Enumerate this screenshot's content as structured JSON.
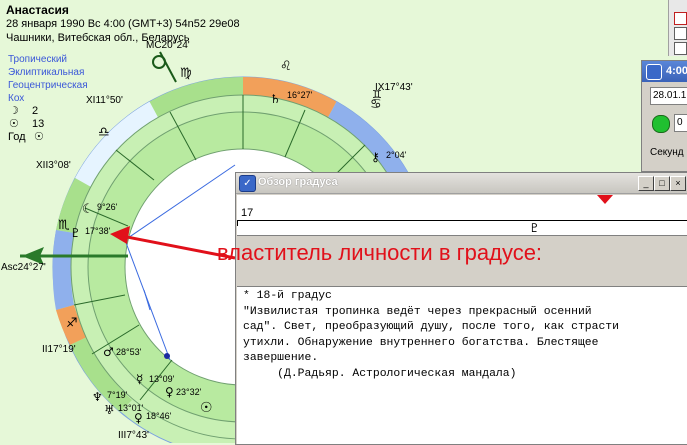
{
  "header": {
    "name": "Анастасия",
    "date_line": "28 января 1990  Вс    4:00 (GMT+3) 54n52  29e08",
    "place_line": "Чашники, Витебская обл., Беларусь"
  },
  "settings": {
    "zodiac": "Тропический",
    "coordinates": "Эклиптикальная",
    "center": "Геоцентрическая",
    "house_system": "Кох",
    "moon_value": "2",
    "sun_value": "13",
    "year_label": "Год"
  },
  "houses": {
    "mc": "MC20°24'",
    "xi": "XI11°50'",
    "xii": "XII3°08'",
    "asc": "Asc24°27'",
    "ii": "II17°19'",
    "iii": "III7°43'",
    "ix": "IX17°43'"
  },
  "planets": {
    "p1": "16°27'",
    "p2": "2°04'",
    "p3": "9°26'",
    "p4": "17°38'",
    "p5": "28°53'",
    "p6": "13°09'",
    "p7": "23°32'",
    "p8": "7°19'",
    "p9": "13°01'",
    "p10": "18°46'"
  },
  "annotation": {
    "red_caption": "властитель личности в градусе:"
  },
  "degree_window": {
    "title": "Обзор градуса",
    "ruler_number": "17",
    "text_lines": [
      "* 18-й градус",
      "\"Извилистая тропинка ведёт через прекрасный осенний",
      "сад\". Свет, преобразующий душу, после того, как страсти",
      "утихли. Обнаружение внутреннего богатства. Блестящее",
      "завершение.",
      "     (Д.Радьяр. Астрологическая мандала)"
    ]
  },
  "right_window": {
    "time": "4:00",
    "date": "28.01.1",
    "field": "0",
    "seconds_label": "Секунд"
  },
  "colors": {
    "background": "#e6f8d8",
    "red_accent": "#e1101a",
    "zodiac_green": "#a8e08c",
    "zodiac_blue": "#8fb0ec",
    "zodiac_orange": "#f2a05a"
  }
}
